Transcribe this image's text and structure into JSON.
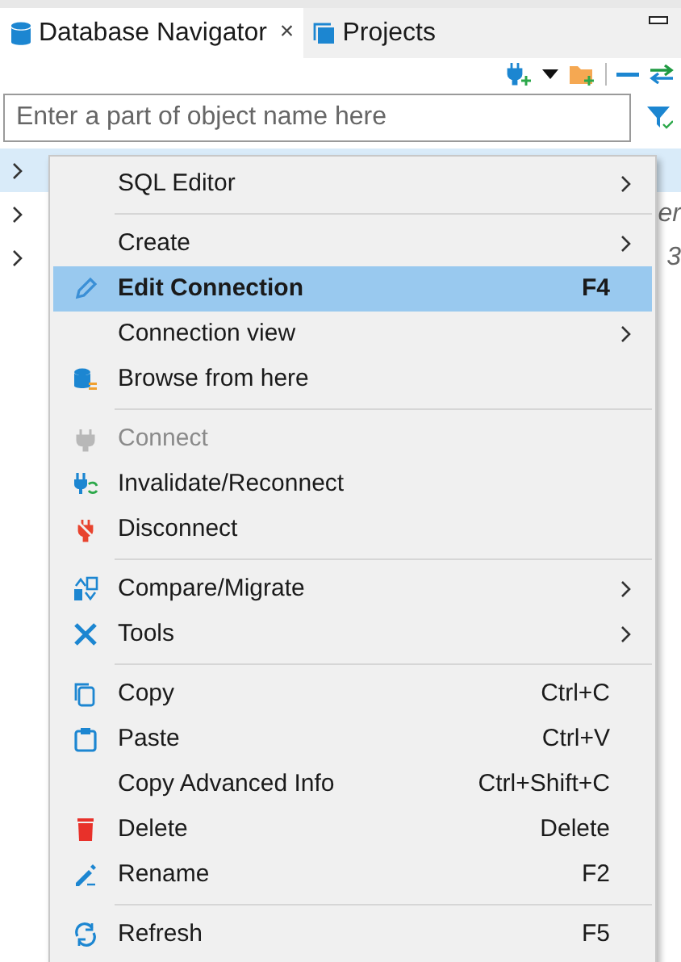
{
  "tabs": [
    {
      "label": "Database Navigator",
      "selected": true,
      "close": "×"
    },
    {
      "label": "Projects",
      "selected": false
    }
  ],
  "search": {
    "placeholder": "Enter a part of object name here"
  },
  "tree": {
    "rows": [
      {
        "selected": true,
        "expanded": false
      },
      {
        "selected": false,
        "expanded": false,
        "text_tail": "er"
      },
      {
        "selected": false,
        "expanded": false,
        "text_tail": "3"
      }
    ]
  },
  "context_menu": {
    "items": [
      {
        "kind": "item",
        "label": "SQL Editor",
        "submenu": true,
        "selected": false,
        "disabled": false
      },
      {
        "kind": "separator"
      },
      {
        "kind": "item",
        "label": "Create",
        "submenu": true,
        "selected": false,
        "disabled": false
      },
      {
        "kind": "item",
        "label": "Edit Connection",
        "shortcut": "F4",
        "submenu": false,
        "selected": true,
        "disabled": false,
        "default": true
      },
      {
        "kind": "item",
        "label": "Connection view",
        "submenu": true,
        "selected": false,
        "disabled": false
      },
      {
        "kind": "item",
        "label": "Browse from here",
        "submenu": false,
        "selected": false,
        "disabled": false
      },
      {
        "kind": "separator"
      },
      {
        "kind": "item",
        "label": "Connect",
        "submenu": false,
        "selected": false,
        "disabled": true
      },
      {
        "kind": "item",
        "label": "Invalidate/Reconnect",
        "submenu": false,
        "selected": false,
        "disabled": false
      },
      {
        "kind": "item",
        "label": "Disconnect",
        "submenu": false,
        "selected": false,
        "disabled": false
      },
      {
        "kind": "separator"
      },
      {
        "kind": "item",
        "label": "Compare/Migrate",
        "submenu": true,
        "selected": false,
        "disabled": false
      },
      {
        "kind": "item",
        "label": "Tools",
        "submenu": true,
        "selected": false,
        "disabled": false
      },
      {
        "kind": "separator"
      },
      {
        "kind": "item",
        "label": "Copy",
        "shortcut": "Ctrl+C",
        "submenu": false,
        "selected": false,
        "disabled": false
      },
      {
        "kind": "item",
        "label": "Paste",
        "shortcut": "Ctrl+V",
        "submenu": false,
        "selected": false,
        "disabled": false
      },
      {
        "kind": "item",
        "label": "Copy Advanced Info",
        "shortcut": "Ctrl+Shift+C",
        "submenu": false,
        "selected": false,
        "disabled": false
      },
      {
        "kind": "item",
        "label": "Delete",
        "shortcut": "Delete",
        "submenu": false,
        "selected": false,
        "disabled": false
      },
      {
        "kind": "item",
        "label": "Rename",
        "shortcut": "F2",
        "submenu": false,
        "selected": false,
        "disabled": false
      },
      {
        "kind": "separator"
      },
      {
        "kind": "item",
        "label": "Refresh",
        "shortcut": "F5",
        "submenu": false,
        "selected": false,
        "disabled": false
      }
    ]
  }
}
